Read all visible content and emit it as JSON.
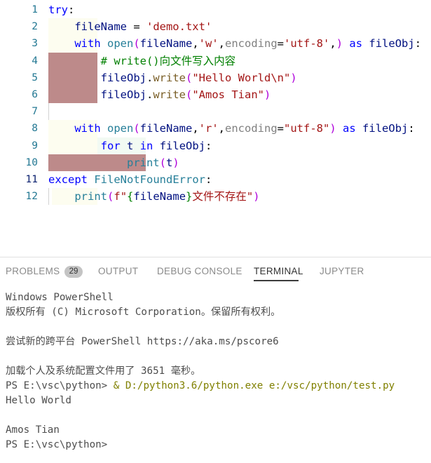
{
  "editor": {
    "language": "python",
    "lines": [
      {
        "n": "1",
        "indent": 0,
        "text": "try:"
      },
      {
        "n": "2",
        "indent": 1,
        "text": "    fileName = 'demo.txt'"
      },
      {
        "n": "3",
        "indent": 1,
        "text": "    with open(fileName,'w',encoding='utf-8',) as fileObj:"
      },
      {
        "n": "4",
        "indent": 2,
        "text": "        # write()向文件写入内容"
      },
      {
        "n": "5",
        "indent": 2,
        "text": "        fileObj.write(\"Hello World\\n\")"
      },
      {
        "n": "6",
        "indent": 2,
        "text": "        fileObj.write(\"Amos Tian\")"
      },
      {
        "n": "7",
        "indent": 0,
        "text": ""
      },
      {
        "n": "8",
        "indent": 1,
        "text": "    with open(fileName,'r',encoding=\"utf-8\") as fileObj:"
      },
      {
        "n": "9",
        "indent": 2,
        "text": "        for t in fileObj:"
      },
      {
        "n": "10",
        "indent": 4,
        "text": "            print(t)"
      },
      {
        "n": "11",
        "indent": 0,
        "text": "except FileNotFoundError:"
      },
      {
        "n": "12",
        "indent": 1,
        "text": "    print(f\"{fileName}文件不存在\")"
      }
    ],
    "active_line": "11",
    "selection_color": "#bd8a8a",
    "indent_tint_level1": "#fdfdf0",
    "indent_tint_level2": "#f2faf3",
    "linenumber_color": "#237893"
  },
  "panel": {
    "tabs": [
      {
        "label": "PROBLEMS",
        "active": false,
        "badge": "29"
      },
      {
        "label": "OUTPUT",
        "active": false,
        "badge": null
      },
      {
        "label": "DEBUG CONSOLE",
        "active": false,
        "badge": null
      },
      {
        "label": "TERMINAL",
        "active": true,
        "badge": null
      },
      {
        "label": "JUPYTER",
        "active": false,
        "badge": null
      }
    ],
    "active_tab": "TERMINAL",
    "active_tab_color": "#333333",
    "inactive_tab_color": "#8a8a8a",
    "badge_background": "#c4c4c4"
  },
  "terminal": {
    "lines": [
      {
        "text": "Windows PowerShell",
        "kind": "plain"
      },
      {
        "text": "版权所有 (C) Microsoft Corporation。保留所有权利。",
        "kind": "plain"
      },
      {
        "text": "",
        "kind": "plain"
      },
      {
        "text": "尝试新的跨平台 PowerShell https://aka.ms/pscore6",
        "kind": "plain"
      },
      {
        "text": "",
        "kind": "plain"
      },
      {
        "text": "加载个人及系统配置文件用了 3651 毫秒。",
        "kind": "plain"
      },
      {
        "text": "PS E:\\vsc\\python> ",
        "kind": "prompt",
        "command": "& D:/python3.6/python.exe e:/vsc/python/test.py"
      },
      {
        "text": "Hello World",
        "kind": "plain"
      },
      {
        "text": "",
        "kind": "plain"
      },
      {
        "text": "Amos Tian",
        "kind": "plain"
      },
      {
        "text": "PS E:\\vsc\\python>",
        "kind": "plain"
      }
    ],
    "text_color": "#4d4d4d",
    "command_color": "#808000"
  }
}
